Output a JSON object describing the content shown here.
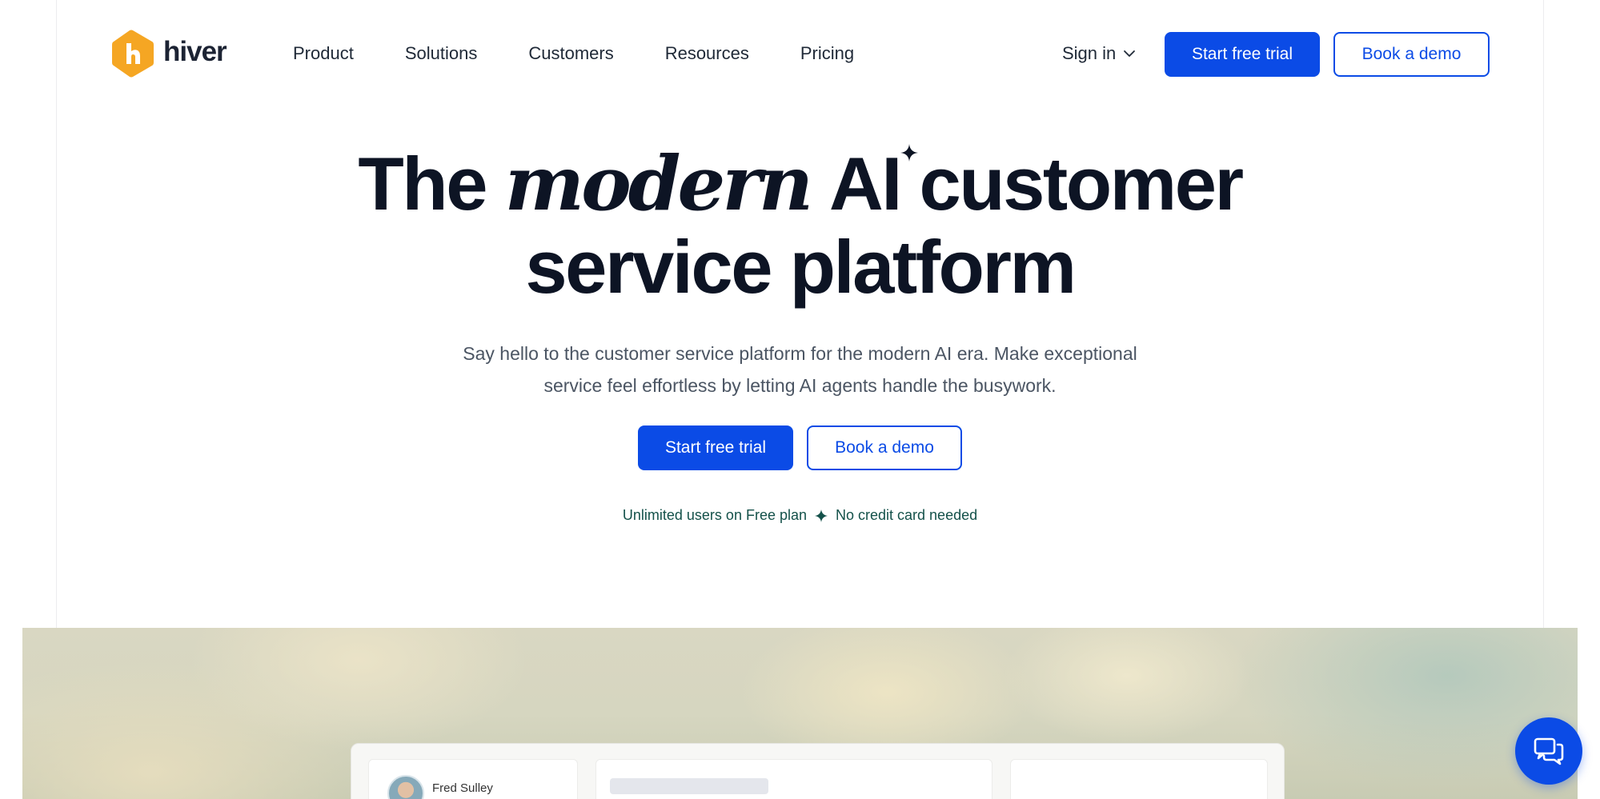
{
  "brand": {
    "name": "hiver",
    "color": "#f5a623"
  },
  "colors": {
    "primary": "#0b4be6",
    "note": "#14514a"
  },
  "nav": {
    "links": [
      "Product",
      "Solutions",
      "Customers",
      "Resources",
      "Pricing"
    ],
    "signin_label": "Sign in",
    "trial_label": "Start free trial",
    "demo_label": "Book a demo"
  },
  "hero": {
    "title_the": "The",
    "title_modern": "modern",
    "title_ai": "AI",
    "title_customer": "customer",
    "title_line2": "service platform",
    "subtitle_line1": "Say hello to the customer service platform for the modern AI era. Make exceptional",
    "subtitle_line2": "service feel effortless by letting AI agents handle the busywork.",
    "trial_label": "Start free trial",
    "demo_label": "Book a demo",
    "note_left": "Unlimited users on Free plan",
    "note_right": "No credit card needed"
  },
  "preview": {
    "contact_name": "Fred Sulley"
  },
  "icons": {
    "signin_chevron": "chevron-down-icon",
    "sparkle": "sparkle-icon",
    "chat": "chat-icon"
  }
}
